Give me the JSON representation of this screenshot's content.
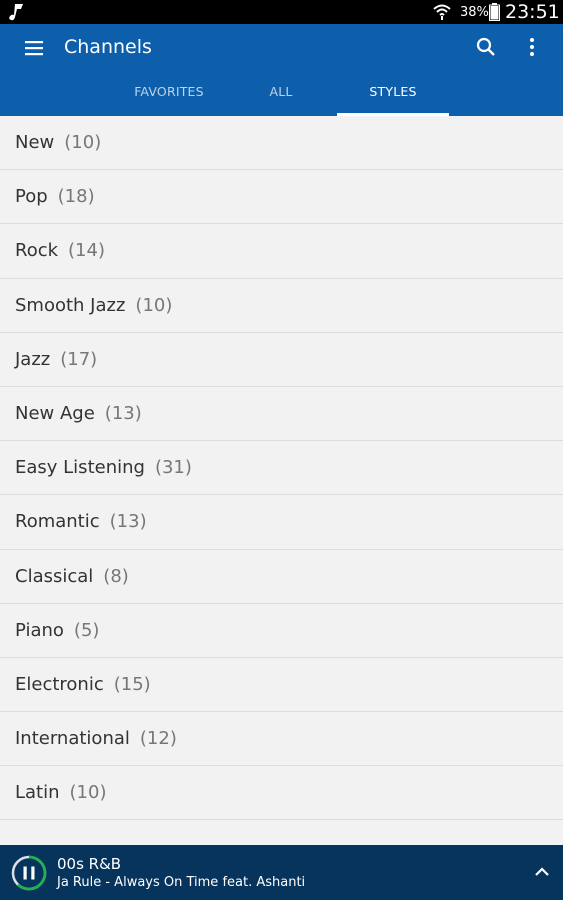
{
  "status_bar": {
    "battery_percent": "38%",
    "time": "23:51"
  },
  "app_bar": {
    "title": "Channels"
  },
  "tabs": [
    {
      "label": "FAVORITES",
      "active": false
    },
    {
      "label": "ALL",
      "active": false
    },
    {
      "label": "STYLES",
      "active": true
    }
  ],
  "styles": [
    {
      "name": "New",
      "count": "(10)"
    },
    {
      "name": "Pop",
      "count": "(18)"
    },
    {
      "name": "Rock",
      "count": "(14)"
    },
    {
      "name": "Smooth Jazz",
      "count": "(10)"
    },
    {
      "name": "Jazz",
      "count": "(17)"
    },
    {
      "name": "New Age",
      "count": "(13)"
    },
    {
      "name": "Easy Listening",
      "count": "(31)"
    },
    {
      "name": "Romantic",
      "count": "(13)"
    },
    {
      "name": "Classical",
      "count": "(8)"
    },
    {
      "name": "Piano",
      "count": "(5)"
    },
    {
      "name": "Electronic",
      "count": "(15)"
    },
    {
      "name": "International",
      "count": "(12)"
    },
    {
      "name": "Latin",
      "count": "(10)"
    }
  ],
  "player": {
    "station": "00s R&B",
    "track": "Ja Rule - Always On Time feat. Ashanti",
    "progress": 0.62
  },
  "colors": {
    "app_bar": "#0d5fab",
    "player_bar": "#07345d",
    "progress_ring": "#22b14c"
  },
  "icons": {
    "status_app": "music-note-icon",
    "wifi": "wifi-icon",
    "battery": "battery-icon",
    "menu": "hamburger-menu-icon",
    "search": "search-icon",
    "more": "more-vert-icon",
    "pause": "pause-icon",
    "expand": "chevron-up-icon"
  }
}
